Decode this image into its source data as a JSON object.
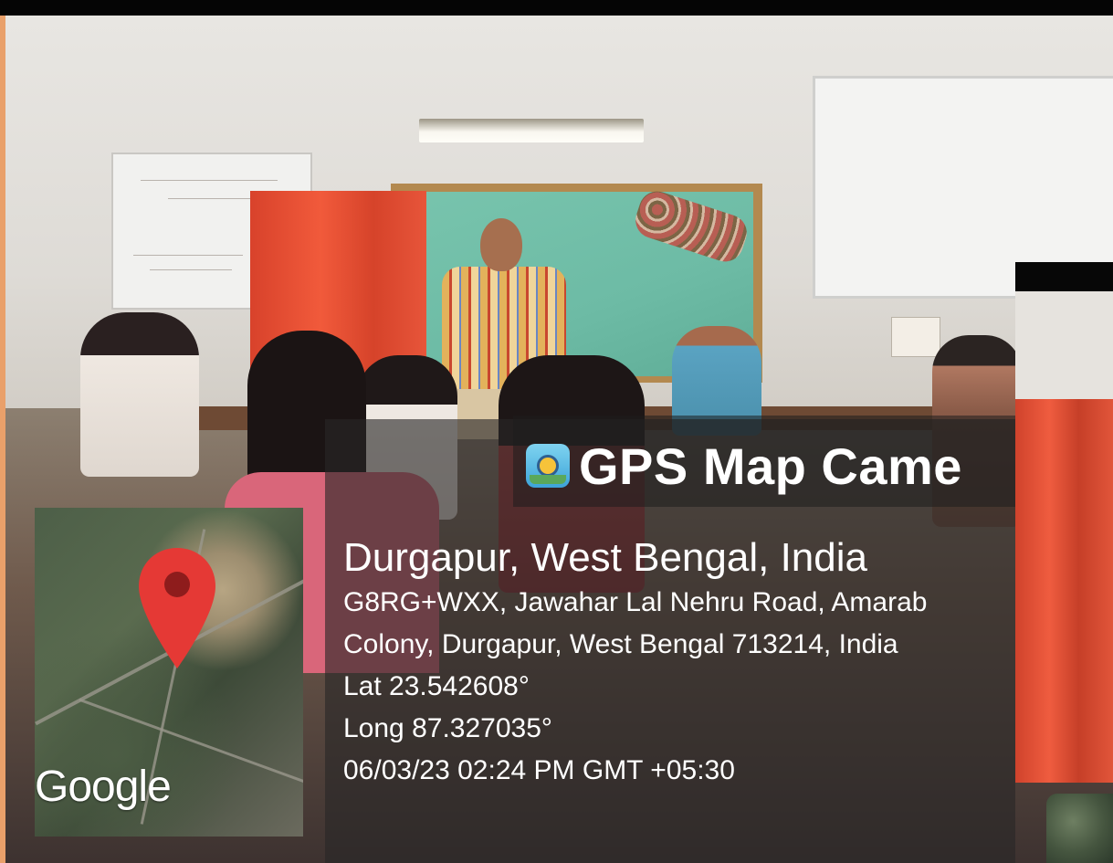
{
  "overlay": {
    "app_name": "GPS Map Came",
    "app_icon": "gps-map-camera-icon",
    "city": "Durgapur, West Bengal, India",
    "address_line_1": "G8RG+WXX, Jawahar Lal Nehru Road, Amarab",
    "address_line_2": "Colony, Durgapur, West Bengal 713214, India",
    "latitude": "Lat 23.542608°",
    "longitude": "Long 87.327035°",
    "timestamp": "06/03/23 02:24 PM GMT +05:30"
  },
  "map": {
    "logo_text": "Google",
    "pin_color": "#e53935"
  },
  "colors": {
    "curtain": "#e8553a",
    "chalkboard": "#6dbba5",
    "overlay_text": "#ffffff"
  }
}
